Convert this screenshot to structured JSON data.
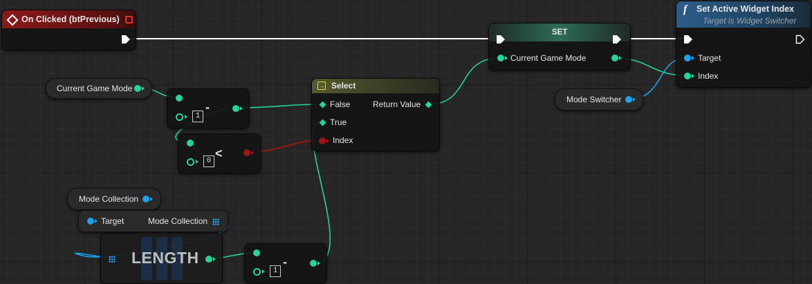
{
  "event_node": {
    "title": "On Clicked (btPrevious)",
    "color": "#8b1a1a"
  },
  "set_node": {
    "title": "SET",
    "pin_label": "Current Game Mode"
  },
  "function_node": {
    "title": "Set Active Widget Index",
    "subtitle": "Target is Widget Switcher",
    "pin_target": "Target",
    "pin_index": "Index"
  },
  "var_current_game_mode": {
    "label": "Current Game Mode"
  },
  "var_mode_switcher": {
    "label": "Mode Switcher"
  },
  "var_mode_collection": {
    "label": "Mode Collection"
  },
  "subtract_node_1": {
    "value": "1",
    "operator": "-"
  },
  "less_node": {
    "value": "0",
    "operator": "<"
  },
  "select_node": {
    "title": "Select",
    "pin_false": "False",
    "pin_true": "True",
    "pin_index": "Index",
    "pin_return": "Return Value"
  },
  "length_node": {
    "pin_target": "Target",
    "pin_collection": "Mode Collection",
    "title": "LENGTH"
  },
  "subtract_node_2": {
    "value": "1",
    "operator": "-"
  },
  "colors": {
    "exec": "#ffffff",
    "integer": "#22d59a",
    "object": "#1aa3f0",
    "boolean": "#a01414",
    "header_function": "#2c5e8a",
    "header_select": "#555a2c"
  }
}
